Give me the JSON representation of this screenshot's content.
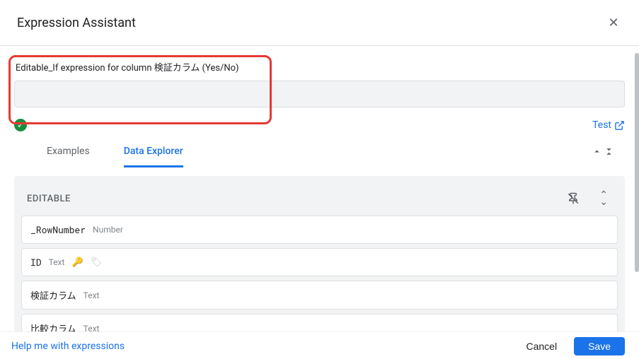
{
  "header": {
    "title": "Expression Assistant"
  },
  "expression": {
    "label": "Editable_If expression for column 検証カラム (Yes/No)",
    "value": ""
  },
  "status": {
    "valid": true
  },
  "test_link": "Test",
  "tabs": {
    "examples": "Examples",
    "data_explorer": "Data Explorer",
    "active": "data_explorer"
  },
  "data_explorer": {
    "title": "EDITABLE",
    "columns": [
      {
        "name": "_RowNumber",
        "type": "Number",
        "is_key": false,
        "has_tag": false
      },
      {
        "name": "ID",
        "type": "Text",
        "is_key": true,
        "has_tag": true
      },
      {
        "name": "検証カラム",
        "type": "Text",
        "is_key": false,
        "has_tag": false
      },
      {
        "name": "比較カラム",
        "type": "Text",
        "is_key": false,
        "has_tag": false
      }
    ]
  },
  "footer": {
    "help": "Help me with expressions",
    "cancel": "Cancel",
    "save": "Save"
  }
}
